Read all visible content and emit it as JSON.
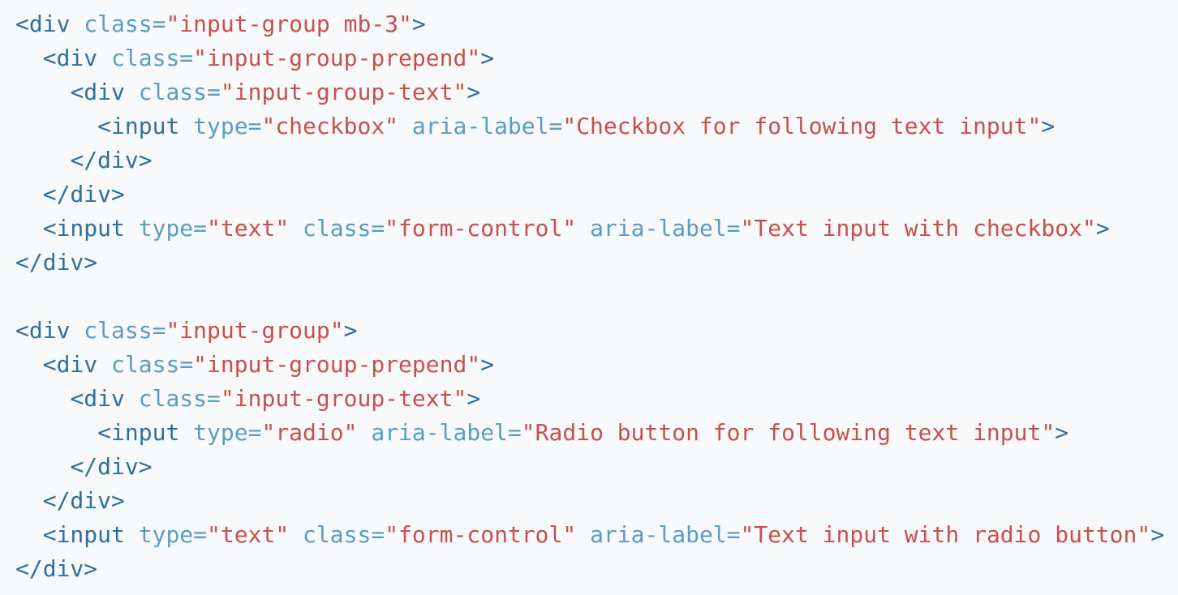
{
  "code": {
    "lines": [
      {
        "indent": "",
        "tokens": [
          {
            "t": "tag",
            "v": "<div"
          },
          {
            "t": "sp",
            "v": " "
          },
          {
            "t": "attr",
            "v": "class="
          },
          {
            "t": "val",
            "v": "\"input-group mb-3\""
          },
          {
            "t": "tag",
            "v": ">"
          }
        ]
      },
      {
        "indent": "  ",
        "tokens": [
          {
            "t": "tag",
            "v": "<div"
          },
          {
            "t": "sp",
            "v": " "
          },
          {
            "t": "attr",
            "v": "class="
          },
          {
            "t": "val",
            "v": "\"input-group-prepend\""
          },
          {
            "t": "tag",
            "v": ">"
          }
        ]
      },
      {
        "indent": "    ",
        "tokens": [
          {
            "t": "tag",
            "v": "<div"
          },
          {
            "t": "sp",
            "v": " "
          },
          {
            "t": "attr",
            "v": "class="
          },
          {
            "t": "val",
            "v": "\"input-group-text\""
          },
          {
            "t": "tag",
            "v": ">"
          }
        ]
      },
      {
        "indent": "      ",
        "tokens": [
          {
            "t": "tag",
            "v": "<input"
          },
          {
            "t": "sp",
            "v": " "
          },
          {
            "t": "attr",
            "v": "type="
          },
          {
            "t": "val",
            "v": "\"checkbox\""
          },
          {
            "t": "sp",
            "v": " "
          },
          {
            "t": "attr",
            "v": "aria-label="
          },
          {
            "t": "val",
            "v": "\"Checkbox for following text input\""
          },
          {
            "t": "tag",
            "v": ">"
          }
        ]
      },
      {
        "indent": "    ",
        "tokens": [
          {
            "t": "tag",
            "v": "</div>"
          }
        ]
      },
      {
        "indent": "  ",
        "tokens": [
          {
            "t": "tag",
            "v": "</div>"
          }
        ]
      },
      {
        "indent": "  ",
        "tokens": [
          {
            "t": "tag",
            "v": "<input"
          },
          {
            "t": "sp",
            "v": " "
          },
          {
            "t": "attr",
            "v": "type="
          },
          {
            "t": "val",
            "v": "\"text\""
          },
          {
            "t": "sp",
            "v": " "
          },
          {
            "t": "attr",
            "v": "class="
          },
          {
            "t": "val",
            "v": "\"form-control\""
          },
          {
            "t": "sp",
            "v": " "
          },
          {
            "t": "attr",
            "v": "aria-label="
          },
          {
            "t": "val",
            "v": "\"Text input with checkbox\""
          },
          {
            "t": "tag",
            "v": ">"
          }
        ]
      },
      {
        "indent": "",
        "tokens": [
          {
            "t": "tag",
            "v": "</div>"
          }
        ]
      },
      {
        "indent": "",
        "tokens": []
      },
      {
        "indent": "",
        "tokens": [
          {
            "t": "tag",
            "v": "<div"
          },
          {
            "t": "sp",
            "v": " "
          },
          {
            "t": "attr",
            "v": "class="
          },
          {
            "t": "val",
            "v": "\"input-group\""
          },
          {
            "t": "tag",
            "v": ">"
          }
        ]
      },
      {
        "indent": "  ",
        "tokens": [
          {
            "t": "tag",
            "v": "<div"
          },
          {
            "t": "sp",
            "v": " "
          },
          {
            "t": "attr",
            "v": "class="
          },
          {
            "t": "val",
            "v": "\"input-group-prepend\""
          },
          {
            "t": "tag",
            "v": ">"
          }
        ]
      },
      {
        "indent": "    ",
        "tokens": [
          {
            "t": "tag",
            "v": "<div"
          },
          {
            "t": "sp",
            "v": " "
          },
          {
            "t": "attr",
            "v": "class="
          },
          {
            "t": "val",
            "v": "\"input-group-text\""
          },
          {
            "t": "tag",
            "v": ">"
          }
        ]
      },
      {
        "indent": "      ",
        "tokens": [
          {
            "t": "tag",
            "v": "<input"
          },
          {
            "t": "sp",
            "v": " "
          },
          {
            "t": "attr",
            "v": "type="
          },
          {
            "t": "val",
            "v": "\"radio\""
          },
          {
            "t": "sp",
            "v": " "
          },
          {
            "t": "attr",
            "v": "aria-label="
          },
          {
            "t": "val",
            "v": "\"Radio button for following text input\""
          },
          {
            "t": "tag",
            "v": ">"
          }
        ]
      },
      {
        "indent": "    ",
        "tokens": [
          {
            "t": "tag",
            "v": "</div>"
          }
        ]
      },
      {
        "indent": "  ",
        "tokens": [
          {
            "t": "tag",
            "v": "</div>"
          }
        ]
      },
      {
        "indent": "  ",
        "tokens": [
          {
            "t": "tag",
            "v": "<input"
          },
          {
            "t": "sp",
            "v": " "
          },
          {
            "t": "attr",
            "v": "type="
          },
          {
            "t": "val",
            "v": "\"text\""
          },
          {
            "t": "sp",
            "v": " "
          },
          {
            "t": "attr",
            "v": "class="
          },
          {
            "t": "val",
            "v": "\"form-control\""
          },
          {
            "t": "sp",
            "v": " "
          },
          {
            "t": "attr",
            "v": "aria-label="
          },
          {
            "t": "val",
            "v": "\"Text input with radio button\""
          },
          {
            "t": "tag",
            "v": ">"
          }
        ]
      },
      {
        "indent": "",
        "tokens": [
          {
            "t": "tag",
            "v": "</div>"
          }
        ]
      }
    ]
  }
}
